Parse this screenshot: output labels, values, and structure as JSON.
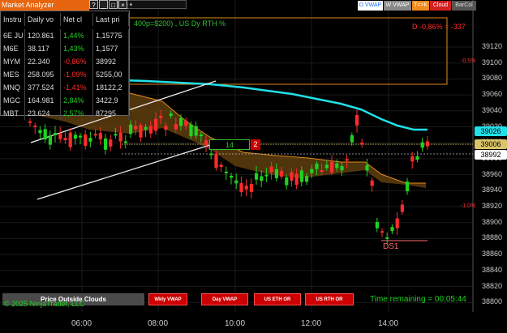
{
  "market_analyzer": {
    "title": "Market Analyzer",
    "controls": [
      "?",
      "_",
      "□",
      "×"
    ],
    "columns": [
      "Instru",
      "Daily vo",
      "Net cl",
      "Last pri"
    ],
    "rows": [
      {
        "instrument": "6E JU",
        "volume": "120.861",
        "change": "1,44%",
        "last": "1,15775",
        "dir": "up"
      },
      {
        "instrument": "M6E",
        "volume": "38.117",
        "change": "1,43%",
        "last": "1,1577",
        "dir": "up"
      },
      {
        "instrument": "MYM",
        "volume": "22.340",
        "change": "-0,86%",
        "last": "38992",
        "dir": "dn"
      },
      {
        "instrument": "MES",
        "volume": "258.095",
        "change": "-1,09%",
        "last": "5255,00",
        "dir": "dn"
      },
      {
        "instrument": "MNQ",
        "volume": "377.524",
        "change": "-1,41%",
        "last": "18122,2",
        "dir": "dn"
      },
      {
        "instrument": "MGC",
        "volume": "164.981",
        "change": "2,84%",
        "last": "3422,9",
        "dir": "up"
      },
      {
        "instrument": "MBT",
        "volume": "23.624",
        "change": "2,57%",
        "last": "87295",
        "dir": "up"
      }
    ]
  },
  "toolbar": {
    "timeframe": "ute",
    "buttons": [
      {
        "label": "D VWAP",
        "color": "#1e6fff",
        "bg": "#ffffff"
      },
      {
        "label": "W VWAP",
        "color": "#ffffff",
        "bg": "#888888"
      },
      {
        "label": "T<>K",
        "color": "#ffffff",
        "bg": "#f08a1e"
      },
      {
        "label": "Cloud",
        "color": "#ffffff",
        "bg": "#d22020"
      },
      {
        "label": "BarCol",
        "color": "#dddddd",
        "bg": "#555555"
      }
    ]
  },
  "chart_header": "400p=$200) , US Dy RTH %",
  "pnl_text": "D -0,86% = -337",
  "pct_labels": {
    "upper": "-0.5%",
    "lower": "-1.0%"
  },
  "y_axis": [
    "39120",
    "39100",
    "39080",
    "39060",
    "39040",
    "39020",
    "39000",
    "38980",
    "38960",
    "38940",
    "38920",
    "38900",
    "38880",
    "38860",
    "38840",
    "38820",
    "38800"
  ],
  "x_axis": [
    "06:00",
    "08:00",
    "10:00",
    "12:00",
    "14:00"
  ],
  "price_tags": {
    "vwap": "39026",
    "open": "39006",
    "last": "38992"
  },
  "trade_box": {
    "count": "14",
    "badge": "2"
  },
  "ds_label": "DS1",
  "bottom_panel": {
    "title": "Price Outside Clouds",
    "copyright": "© 2025 NinjaTrader, LLC",
    "buttons": [
      "Wkly VWAP",
      "Day VWAP",
      "US ETH OR",
      "US RTH OR"
    ],
    "time_remaining": "Time remaining = 00:05:44"
  },
  "colors": {
    "up": "#1fd21f",
    "down": "#ff2b2b",
    "vwap": "#20e0e8",
    "cloud": "#8a5a10",
    "accent": "#e8650f"
  }
}
